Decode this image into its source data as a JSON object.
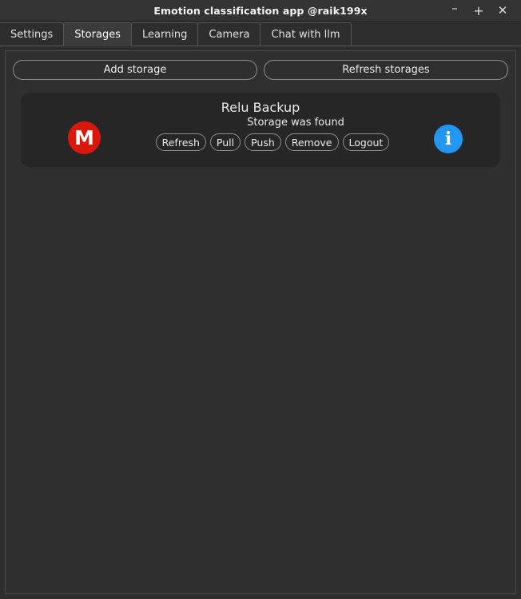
{
  "window": {
    "title": "Emotion classification app @raik199x",
    "controls": {
      "minimize": "–",
      "maximize": "+",
      "close": "✕"
    }
  },
  "tabs": [
    {
      "label": "Settings",
      "active": false
    },
    {
      "label": "Storages",
      "active": true
    },
    {
      "label": "Learning",
      "active": false
    },
    {
      "label": "Camera",
      "active": false
    },
    {
      "label": "Chat with llm",
      "active": false
    }
  ],
  "toolbar": {
    "add_storage_label": "Add storage",
    "refresh_storages_label": "Refresh storages"
  },
  "storage_card": {
    "title": "Relu Backup",
    "status": "Storage was found",
    "provider_glyph": "M",
    "provider_color": "#d9180b",
    "info_glyph": "i",
    "info_color": "#2196f3",
    "actions": [
      {
        "label": "Refresh"
      },
      {
        "label": "Pull"
      },
      {
        "label": "Push"
      },
      {
        "label": "Remove"
      },
      {
        "label": "Logout"
      }
    ]
  },
  "colors": {
    "window_bg": "#2d2d2d",
    "titlebar_bg": "#333333",
    "panel_bg": "#2f2f2f",
    "card_bg": "#262626",
    "active_tab_bg": "#3b3b3b",
    "border": "#4a4a4a",
    "text": "#e8e8e8"
  }
}
